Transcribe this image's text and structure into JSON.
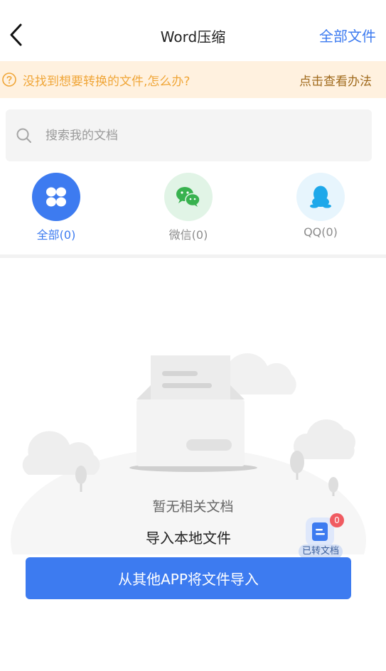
{
  "header": {
    "title": "Word压缩",
    "right_link": "全部文件"
  },
  "tip": {
    "text": "没找到想要转换的文件,怎么办?",
    "link": "点击查看办法"
  },
  "search": {
    "placeholder": "搜索我的文档"
  },
  "categories": [
    {
      "label": "全部(0)",
      "icon": "grid-icon",
      "active": true
    },
    {
      "label": "微信(0)",
      "icon": "wechat-icon",
      "active": false
    },
    {
      "label": "QQ(0)",
      "icon": "qq-icon",
      "active": false
    }
  ],
  "empty_state": {
    "message": "暂无相关文档",
    "import_local": "导入本地文件"
  },
  "converted": {
    "label": "已转文档",
    "count": "0"
  },
  "import_button": {
    "label": "从其他APP将文件导入"
  },
  "colors": {
    "accent": "#3d7bf0",
    "tip_bg": "#fff1df",
    "tip_text": "#f0a638",
    "badge": "#f05b61"
  }
}
